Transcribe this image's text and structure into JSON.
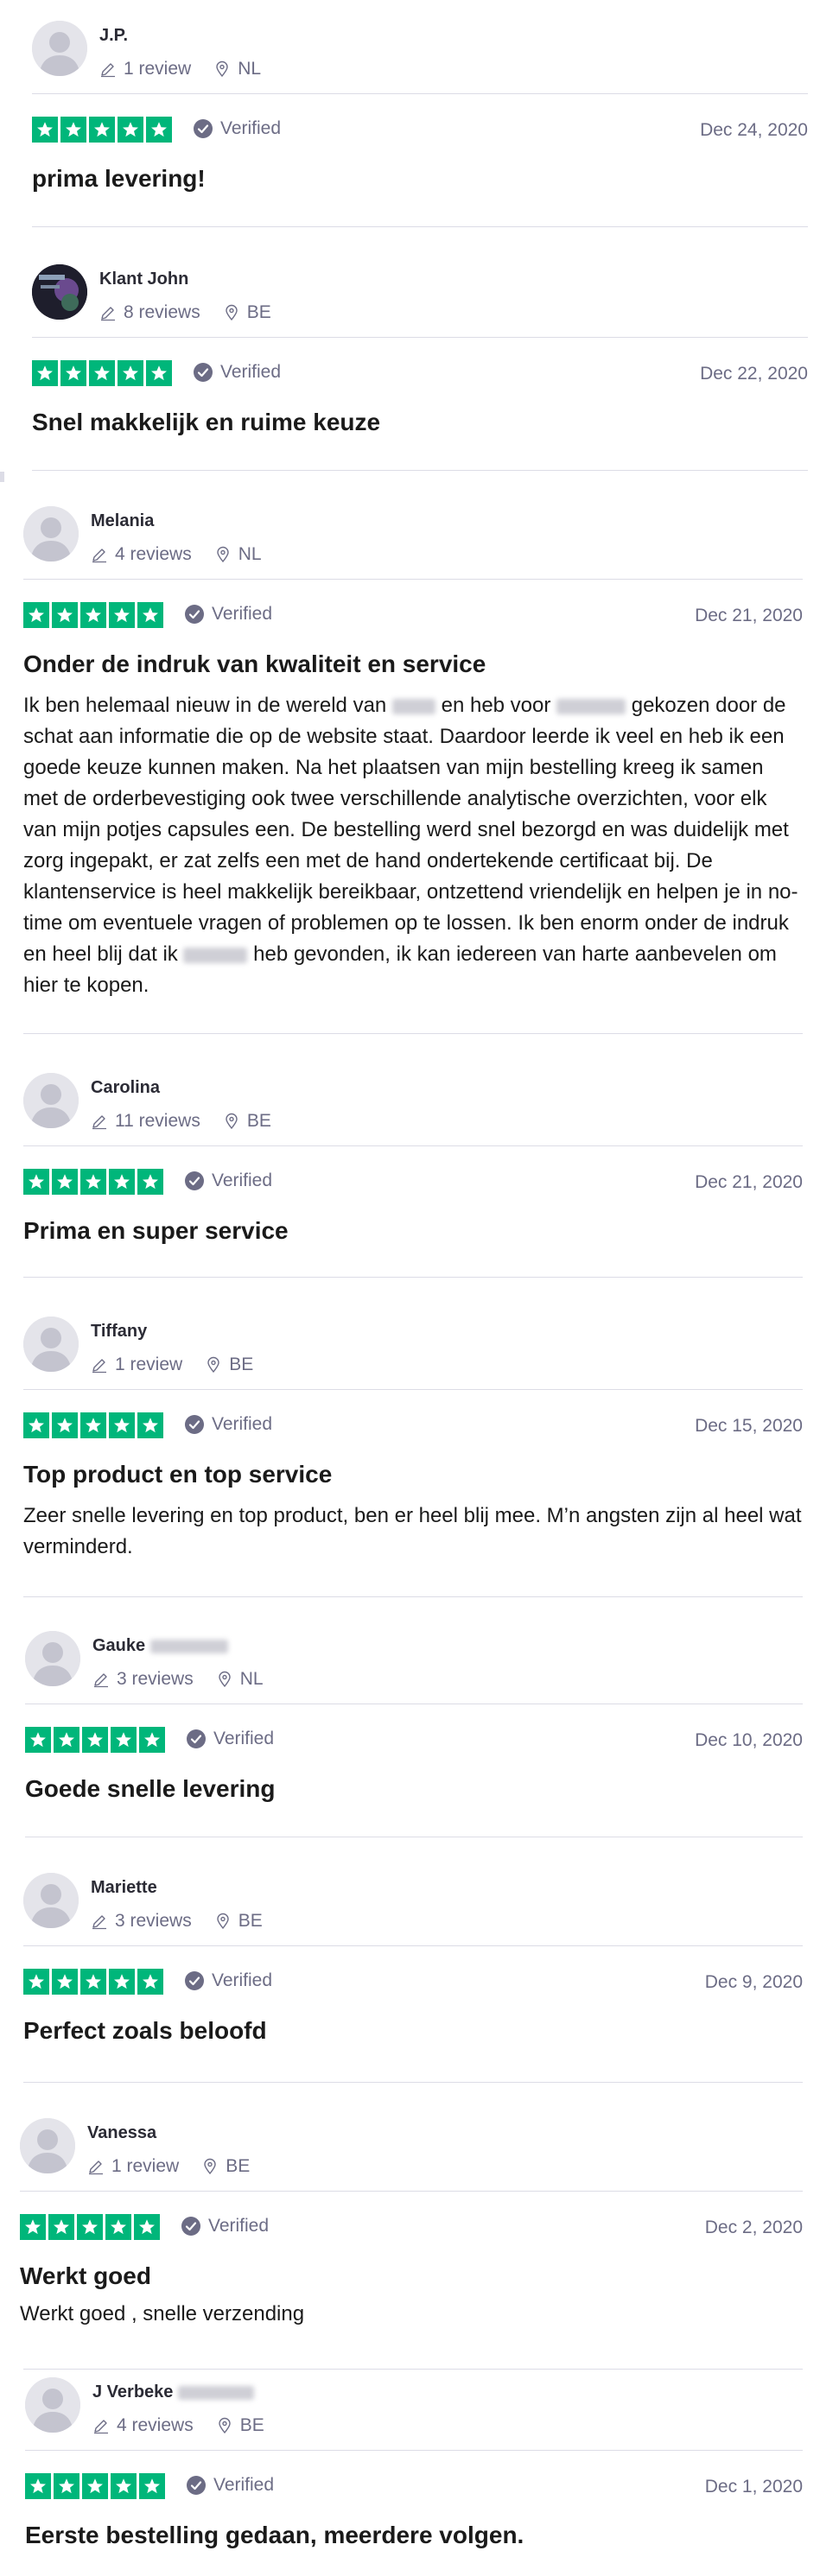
{
  "colors": {
    "star_green": "#00b67a",
    "muted": "#6c6c85",
    "divider": "#dcdce6"
  },
  "icons": {
    "review_count": "pencil-icon",
    "location": "location-pin-icon",
    "verified": "check-circle-icon",
    "star": "star-icon",
    "avatar": "user-avatar-icon"
  },
  "rating_stars": 5,
  "verified_label": "Verified",
  "reviews": [
    {
      "name": "J.P.",
      "count": "1 review",
      "country": "NL",
      "date": "Dec 24, 2020",
      "title": "prima levering!"
    },
    {
      "name": "Klant John",
      "count": "8 reviews",
      "country": "BE",
      "date": "Dec 22, 2020",
      "title": "Snel makkelijk en ruime keuze"
    },
    {
      "name": "Melania",
      "count": "4 reviews",
      "country": "NL",
      "date": "Dec 21, 2020",
      "title": "Onder de indruk van kwaliteit en service",
      "body": {
        "p1": "Ik ben helemaal nieuw in de wereld van",
        "p2": "en heb voor",
        "p3": "gekozen door de schat aan informatie die op de website staat. Daardoor leerde ik veel en heb ik een goede keuze kunnen maken. Na het plaatsen van mijn bestelling kreeg ik samen met de orderbevestiging ook twee verschillende analytische overzichten, voor elk van mijn potjes capsules een. De bestelling werd snel bezorgd en was duidelijk met zorg ingepakt, er zat zelfs een met de hand ondertekende certificaat bij. De klantenservice is heel makkelijk bereikbaar, ontzettend vriendelijk en helpen je in no-time om eventuele vragen of problemen op te lossen. Ik ben enorm onder de indruk en heel blij dat ik",
        "p4": "heb gevonden, ik kan iedereen van harte aanbevelen om hier te kopen."
      }
    },
    {
      "name": "Carolina",
      "count": "11 reviews",
      "country": "BE",
      "date": "Dec 21, 2020",
      "title": "Prima en super service"
    },
    {
      "name": "Tiffany",
      "count": "1 review",
      "country": "BE",
      "date": "Dec 15, 2020",
      "title": "Top product en top service",
      "body": "Zeer snelle levering en top product, ben er heel blij mee. M’n angsten zijn al heel wat verminderd."
    },
    {
      "name": "Gauke",
      "count": "3 reviews",
      "country": "NL",
      "date": "Dec 10, 2020",
      "title": "Goede snelle levering"
    },
    {
      "name": "Mariette",
      "count": "3 reviews",
      "country": "BE",
      "date": "Dec 9, 2020",
      "title": "Perfect zoals beloofd"
    },
    {
      "name": "Vanessa",
      "count": "1 review",
      "country": "BE",
      "date": "Dec 2, 2020",
      "title": "Werkt goed",
      "body": "Werkt goed , snelle verzending"
    },
    {
      "name": "J Verbeke",
      "count": "4 reviews",
      "country": "BE",
      "date": "Dec 1, 2020",
      "title": "Eerste bestelling gedaan, meerdere volgen."
    }
  ]
}
